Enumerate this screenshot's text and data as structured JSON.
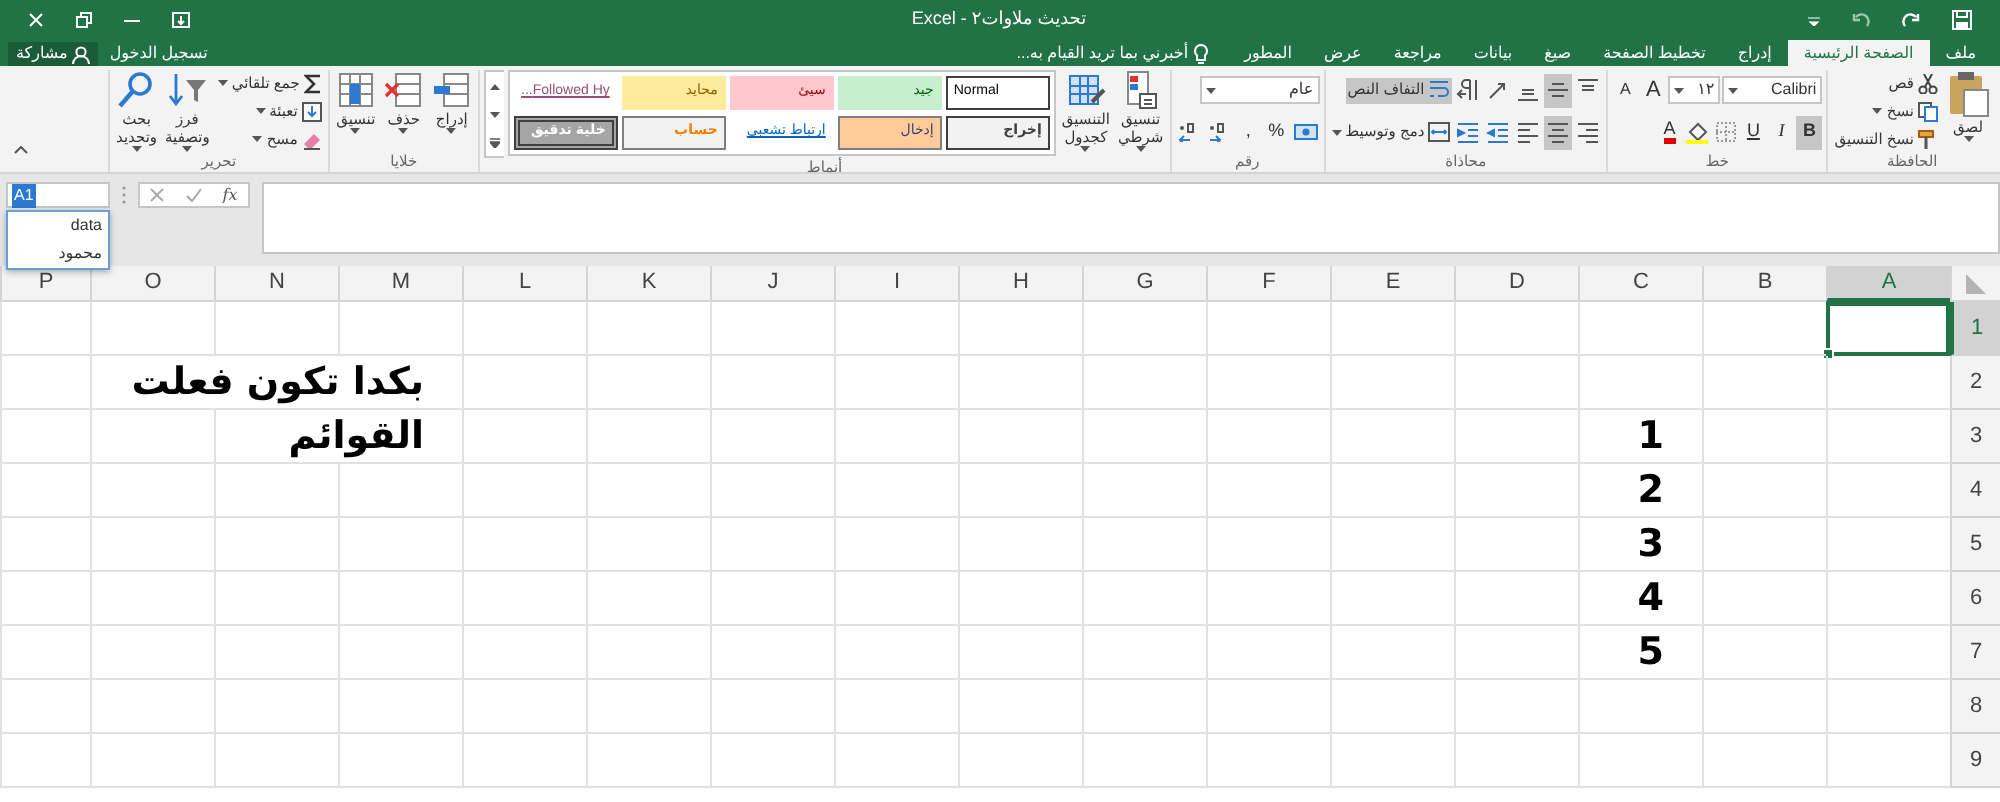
{
  "title_bar": {
    "title": "تحديث ملاوات٢ - Excel"
  },
  "tabs": [
    {
      "label": "ملف",
      "selected": false
    },
    {
      "label": "الصفحة الرئيسية",
      "selected": true
    },
    {
      "label": "إدراج",
      "selected": false
    },
    {
      "label": "تخطيط الصفحة",
      "selected": false
    },
    {
      "label": "صيغ",
      "selected": false
    },
    {
      "label": "بيانات",
      "selected": false
    },
    {
      "label": "مراجعة",
      "selected": false
    },
    {
      "label": "عرض",
      "selected": false
    },
    {
      "label": "المطور",
      "selected": false
    }
  ],
  "tell_me": {
    "placeholder": "أخبرني بما تريد القيام به..."
  },
  "account": {
    "sign_in": "تسجيل الدخول",
    "share": "مشاركة"
  },
  "ribbon": {
    "groups": [
      {
        "kind": "clipboard",
        "label": "الحافظة",
        "paste": "لصق",
        "cut": "قص",
        "copy": "نسخ",
        "format_painter": "نسخ التنسيق"
      },
      {
        "kind": "font",
        "label": "خط",
        "font_name": "Calibri",
        "font_size": "١٢",
        "grow": "A",
        "shrink": "A",
        "bold": {
          "label": "B",
          "on": true
        },
        "italic": "I",
        "underline": "U",
        "font_color": "A"
      },
      {
        "kind": "alignment",
        "label": "محاذاة",
        "vertical_buttons": [
          {
            "selected": false
          },
          {
            "selected": true
          },
          {
            "selected": false
          }
        ],
        "horizontal_buttons": [
          {
            "selected": false
          },
          {
            "selected": true
          },
          {
            "selected": false
          }
        ],
        "wrap_text": {
          "label": "التفاف النص",
          "on": true
        },
        "merge": "دمج وتوسيط"
      },
      {
        "kind": "number",
        "label": "رقم",
        "format": "عام",
        "percent": "%",
        "comma": ","
      },
      {
        "kind": "styles",
        "label": "أنماط",
        "conditional": "تنسيق\nشرطي",
        "as_table": "التنسيق\nكجدول",
        "cell_styles": [
          {
            "label": "Normal",
            "kind": "normal"
          },
          {
            "label": "جيد",
            "kind": "good"
          },
          {
            "label": "سيئ",
            "kind": "bad"
          },
          {
            "label": "محايد",
            "kind": "neutral"
          },
          {
            "label": "Followed Hy...",
            "kind": "followed"
          },
          {
            "label": "إخراج",
            "kind": "output"
          },
          {
            "label": "إدخال",
            "kind": "input"
          },
          {
            "label": "ارتباط تشعبي",
            "kind": "link"
          },
          {
            "label": "حساب",
            "kind": "calc"
          },
          {
            "label": "خلية تدقيق",
            "kind": "check"
          }
        ]
      },
      {
        "kind": "cells",
        "label": "خلايا",
        "insert": "إدراج",
        "delete": "حذف",
        "format": "تنسيق"
      },
      {
        "kind": "editing",
        "label": "تحرير",
        "autosum": "جمع تلقائي",
        "fill": "تعبئة",
        "clear": "مسح",
        "sort": "فرز\nوتصفية",
        "find": "بحث\nوتحديد"
      }
    ]
  },
  "name_box": {
    "value": "A1",
    "names": [
      "data",
      "محمود"
    ]
  },
  "formula_bar": {
    "function_label": "fx"
  },
  "sheet": {
    "columns": [
      {
        "label": "A",
        "selected": true
      },
      {
        "label": "B",
        "selected": false
      },
      {
        "label": "C",
        "selected": false
      },
      {
        "label": "D",
        "selected": false
      },
      {
        "label": "E",
        "selected": false
      },
      {
        "label": "F",
        "selected": false
      },
      {
        "label": "G",
        "selected": false
      },
      {
        "label": "H",
        "selected": false
      },
      {
        "label": "I",
        "selected": false
      },
      {
        "label": "J",
        "selected": false
      },
      {
        "label": "K",
        "selected": false
      },
      {
        "label": "L",
        "selected": false
      },
      {
        "label": "M",
        "selected": false
      },
      {
        "label": "N",
        "selected": false
      },
      {
        "label": "O",
        "selected": false
      },
      {
        "label": "P",
        "selected": false
      }
    ],
    "rows": [
      {
        "label": "1",
        "selected": true
      },
      {
        "label": "2",
        "selected": false,
        "cells": {
          "M": "بكدا تكون فعلت"
        }
      },
      {
        "label": "3",
        "selected": false,
        "cells": {
          "C": "1",
          "M": "القوائم"
        }
      },
      {
        "label": "4",
        "selected": false,
        "cells": {
          "C": "2"
        }
      },
      {
        "label": "5",
        "selected": false,
        "cells": {
          "C": "3"
        }
      },
      {
        "label": "6",
        "selected": false,
        "cells": {
          "C": "4"
        }
      },
      {
        "label": "7",
        "selected": false,
        "cells": {
          "C": "5"
        }
      },
      {
        "label": "8",
        "selected": false
      },
      {
        "label": "9",
        "selected": false
      }
    ]
  }
}
